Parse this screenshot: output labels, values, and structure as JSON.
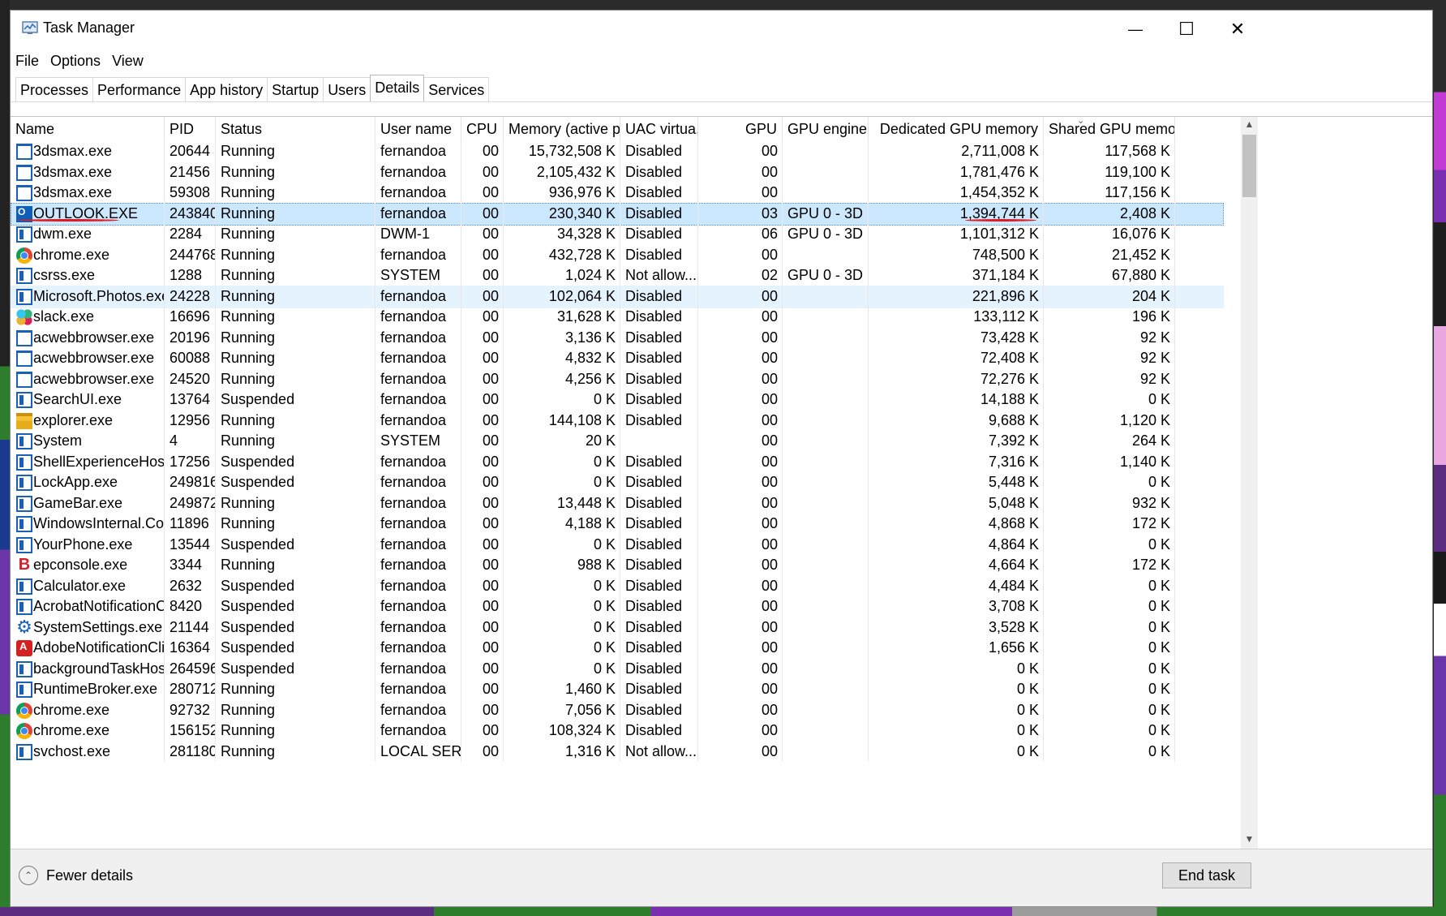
{
  "window": {
    "title": "Task Manager",
    "controls": {
      "minimize": "—",
      "maximize": "☐",
      "close": "✕"
    }
  },
  "menu": [
    "File",
    "Options",
    "View"
  ],
  "tabs": [
    "Processes",
    "Performance",
    "App history",
    "Startup",
    "Users",
    "Details",
    "Services"
  ],
  "active_tab": "Details",
  "columns": [
    "Name",
    "PID",
    "Status",
    "User name",
    "CPU",
    "Memory (active p...",
    "UAC virtua...",
    "GPU",
    "GPU engine",
    "Dedicated GPU memory",
    "Shared GPU memory"
  ],
  "sort_indicator": "⌄",
  "processes": [
    {
      "icon": "window-icon",
      "name": "3dsmax.exe",
      "pid": "20644",
      "status": "Running",
      "user": "fernandoa",
      "cpu": "00",
      "memory": "15,732,508 K",
      "uac": "Disabled",
      "gpu": "00",
      "engine": "",
      "dedicated": "2,711,008 K",
      "shared": "117,568 K"
    },
    {
      "icon": "window-icon",
      "name": "3dsmax.exe",
      "pid": "21456",
      "status": "Running",
      "user": "fernandoa",
      "cpu": "00",
      "memory": "2,105,432 K",
      "uac": "Disabled",
      "gpu": "00",
      "engine": "",
      "dedicated": "1,781,476 K",
      "shared": "119,100 K"
    },
    {
      "icon": "window-icon",
      "name": "3dsmax.exe",
      "pid": "59308",
      "status": "Running",
      "user": "fernandoa",
      "cpu": "00",
      "memory": "936,976 K",
      "uac": "Disabled",
      "gpu": "00",
      "engine": "",
      "dedicated": "1,454,352 K",
      "shared": "117,156 K"
    },
    {
      "icon": "outlook-icon",
      "name": "OUTLOOK.EXE",
      "pid": "243840",
      "status": "Running",
      "user": "fernandoa",
      "cpu": "00",
      "memory": "230,340 K",
      "uac": "Disabled",
      "gpu": "03",
      "engine": "GPU 0 - 3D",
      "dedicated": "1,394,744 K",
      "shared": "2,408 K"
    },
    {
      "icon": "app-icon",
      "name": "dwm.exe",
      "pid": "2284",
      "status": "Running",
      "user": "DWM-1",
      "cpu": "00",
      "memory": "34,328 K",
      "uac": "Disabled",
      "gpu": "06",
      "engine": "GPU 0 - 3D",
      "dedicated": "1,101,312 K",
      "shared": "16,076 K"
    },
    {
      "icon": "chrome-icon",
      "name": "chrome.exe",
      "pid": "244768",
      "status": "Running",
      "user": "fernandoa",
      "cpu": "00",
      "memory": "432,728 K",
      "uac": "Disabled",
      "gpu": "00",
      "engine": "",
      "dedicated": "748,500 K",
      "shared": "21,452 K"
    },
    {
      "icon": "app-icon",
      "name": "csrss.exe",
      "pid": "1288",
      "status": "Running",
      "user": "SYSTEM",
      "cpu": "00",
      "memory": "1,024 K",
      "uac": "Not allow...",
      "gpu": "02",
      "engine": "GPU 0 - 3D",
      "dedicated": "371,184 K",
      "shared": "67,880 K"
    },
    {
      "icon": "app-icon",
      "name": "Microsoft.Photos.exe",
      "pid": "24228",
      "status": "Running",
      "user": "fernandoa",
      "cpu": "00",
      "memory": "102,064 K",
      "uac": "Disabled",
      "gpu": "00",
      "engine": "",
      "dedicated": "221,896 K",
      "shared": "204 K"
    },
    {
      "icon": "slack-icon",
      "name": "slack.exe",
      "pid": "16696",
      "status": "Running",
      "user": "fernandoa",
      "cpu": "00",
      "memory": "31,628 K",
      "uac": "Disabled",
      "gpu": "00",
      "engine": "",
      "dedicated": "133,112 K",
      "shared": "196 K"
    },
    {
      "icon": "window-icon",
      "name": "acwebbrowser.exe",
      "pid": "20196",
      "status": "Running",
      "user": "fernandoa",
      "cpu": "00",
      "memory": "3,136 K",
      "uac": "Disabled",
      "gpu": "00",
      "engine": "",
      "dedicated": "73,428 K",
      "shared": "92 K"
    },
    {
      "icon": "window-icon",
      "name": "acwebbrowser.exe",
      "pid": "60088",
      "status": "Running",
      "user": "fernandoa",
      "cpu": "00",
      "memory": "4,832 K",
      "uac": "Disabled",
      "gpu": "00",
      "engine": "",
      "dedicated": "72,408 K",
      "shared": "92 K"
    },
    {
      "icon": "window-icon",
      "name": "acwebbrowser.exe",
      "pid": "24520",
      "status": "Running",
      "user": "fernandoa",
      "cpu": "00",
      "memory": "4,256 K",
      "uac": "Disabled",
      "gpu": "00",
      "engine": "",
      "dedicated": "72,276 K",
      "shared": "92 K"
    },
    {
      "icon": "app-icon",
      "name": "SearchUI.exe",
      "pid": "13764",
      "status": "Suspended",
      "user": "fernandoa",
      "cpu": "00",
      "memory": "0 K",
      "uac": "Disabled",
      "gpu": "00",
      "engine": "",
      "dedicated": "14,188 K",
      "shared": "0 K"
    },
    {
      "icon": "folder-icon",
      "name": "explorer.exe",
      "pid": "12956",
      "status": "Running",
      "user": "fernandoa",
      "cpu": "00",
      "memory": "144,108 K",
      "uac": "Disabled",
      "gpu": "00",
      "engine": "",
      "dedicated": "9,688 K",
      "shared": "1,120 K"
    },
    {
      "icon": "app-icon",
      "name": "System",
      "pid": "4",
      "status": "Running",
      "user": "SYSTEM",
      "cpu": "00",
      "memory": "20 K",
      "uac": "",
      "gpu": "00",
      "engine": "",
      "dedicated": "7,392 K",
      "shared": "264 K"
    },
    {
      "icon": "app-icon",
      "name": "ShellExperienceHost....",
      "pid": "17256",
      "status": "Suspended",
      "user": "fernandoa",
      "cpu": "00",
      "memory": "0 K",
      "uac": "Disabled",
      "gpu": "00",
      "engine": "",
      "dedicated": "7,316 K",
      "shared": "1,140 K"
    },
    {
      "icon": "app-icon",
      "name": "LockApp.exe",
      "pid": "249816",
      "status": "Suspended",
      "user": "fernandoa",
      "cpu": "00",
      "memory": "0 K",
      "uac": "Disabled",
      "gpu": "00",
      "engine": "",
      "dedicated": "5,448 K",
      "shared": "0 K"
    },
    {
      "icon": "app-icon",
      "name": "GameBar.exe",
      "pid": "249872",
      "status": "Running",
      "user": "fernandoa",
      "cpu": "00",
      "memory": "13,448 K",
      "uac": "Disabled",
      "gpu": "00",
      "engine": "",
      "dedicated": "5,048 K",
      "shared": "932 K"
    },
    {
      "icon": "app-icon",
      "name": "WindowsInternal.Co...",
      "pid": "11896",
      "status": "Running",
      "user": "fernandoa",
      "cpu": "00",
      "memory": "4,188 K",
      "uac": "Disabled",
      "gpu": "00",
      "engine": "",
      "dedicated": "4,868 K",
      "shared": "172 K"
    },
    {
      "icon": "app-icon",
      "name": "YourPhone.exe",
      "pid": "13544",
      "status": "Suspended",
      "user": "fernandoa",
      "cpu": "00",
      "memory": "0 K",
      "uac": "Disabled",
      "gpu": "00",
      "engine": "",
      "dedicated": "4,864 K",
      "shared": "0 K"
    },
    {
      "icon": "b-icon",
      "name": "epconsole.exe",
      "pid": "3344",
      "status": "Running",
      "user": "fernandoa",
      "cpu": "00",
      "memory": "988 K",
      "uac": "Disabled",
      "gpu": "00",
      "engine": "",
      "dedicated": "4,664 K",
      "shared": "172 K"
    },
    {
      "icon": "app-icon",
      "name": "Calculator.exe",
      "pid": "2632",
      "status": "Suspended",
      "user": "fernandoa",
      "cpu": "00",
      "memory": "0 K",
      "uac": "Disabled",
      "gpu": "00",
      "engine": "",
      "dedicated": "4,484 K",
      "shared": "0 K"
    },
    {
      "icon": "app-icon",
      "name": "AcrobatNotificationCl...",
      "pid": "8420",
      "status": "Suspended",
      "user": "fernandoa",
      "cpu": "00",
      "memory": "0 K",
      "uac": "Disabled",
      "gpu": "00",
      "engine": "",
      "dedicated": "3,708 K",
      "shared": "0 K"
    },
    {
      "icon": "gear-icon",
      "name": "SystemSettings.exe",
      "pid": "21144",
      "status": "Suspended",
      "user": "fernandoa",
      "cpu": "00",
      "memory": "0 K",
      "uac": "Disabled",
      "gpu": "00",
      "engine": "",
      "dedicated": "3,528 K",
      "shared": "0 K"
    },
    {
      "icon": "adobe-icon",
      "name": "AdobeNotificationCli...",
      "pid": "16364",
      "status": "Suspended",
      "user": "fernandoa",
      "cpu": "00",
      "memory": "0 K",
      "uac": "Disabled",
      "gpu": "00",
      "engine": "",
      "dedicated": "1,656 K",
      "shared": "0 K"
    },
    {
      "icon": "app-icon",
      "name": "backgroundTaskHost....",
      "pid": "264596",
      "status": "Suspended",
      "user": "fernandoa",
      "cpu": "00",
      "memory": "0 K",
      "uac": "Disabled",
      "gpu": "00",
      "engine": "",
      "dedicated": "0 K",
      "shared": "0 K"
    },
    {
      "icon": "app-icon",
      "name": "RuntimeBroker.exe",
      "pid": "280712",
      "status": "Running",
      "user": "fernandoa",
      "cpu": "00",
      "memory": "1,460 K",
      "uac": "Disabled",
      "gpu": "00",
      "engine": "",
      "dedicated": "0 K",
      "shared": "0 K"
    },
    {
      "icon": "chrome-icon",
      "name": "chrome.exe",
      "pid": "92732",
      "status": "Running",
      "user": "fernandoa",
      "cpu": "00",
      "memory": "7,056 K",
      "uac": "Disabled",
      "gpu": "00",
      "engine": "",
      "dedicated": "0 K",
      "shared": "0 K"
    },
    {
      "icon": "chrome-icon",
      "name": "chrome.exe",
      "pid": "156152",
      "status": "Running",
      "user": "fernandoa",
      "cpu": "00",
      "memory": "108,324 K",
      "uac": "Disabled",
      "gpu": "00",
      "engine": "",
      "dedicated": "0 K",
      "shared": "0 K"
    },
    {
      "icon": "app-icon",
      "name": "svchost.exe",
      "pid": "281180",
      "status": "Running",
      "user": "LOCAL SER...",
      "cpu": "00",
      "memory": "1,316 K",
      "uac": "Not allow...",
      "gpu": "00",
      "engine": "",
      "dedicated": "0 K",
      "shared": "0 K"
    }
  ],
  "selected_index": 3,
  "highlighted_index": 7,
  "scrollbar": {
    "up": "▲",
    "down": "▼"
  },
  "footer": {
    "fewer_details": "Fewer details",
    "fewer_icon": "⌃",
    "end_task": "End task"
  },
  "colors": {
    "selection": "#cce8ff",
    "hover": "#e5f3ff",
    "annotation": "#e01b24"
  }
}
